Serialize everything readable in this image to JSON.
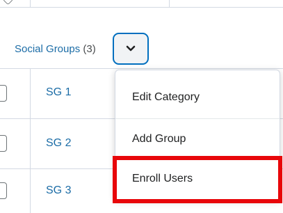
{
  "category": {
    "name": "Social Groups",
    "count": "(3)"
  },
  "groups": [
    {
      "name": "SG 1"
    },
    {
      "name": "SG 2"
    },
    {
      "name": "SG 3"
    }
  ],
  "menu": {
    "items": [
      {
        "label": "Edit Category"
      },
      {
        "label": "Add Group"
      },
      {
        "label": "Enroll Users"
      }
    ]
  },
  "colors": {
    "link": "#1b6ca6",
    "focus_border": "#006fbf",
    "highlight": "#e8070a"
  }
}
